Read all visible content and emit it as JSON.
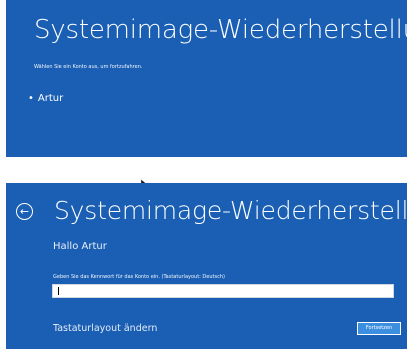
{
  "screen1": {
    "title": "Systemimage-Wiederherstellung",
    "instruction": "Wählen Sie ein Konto aus, um fortzufahren.",
    "accounts": [
      "Artur"
    ]
  },
  "screen2": {
    "title": "Systemimage-Wiederherstellung",
    "greeting": "Hallo Artur",
    "password_label": "Geben Sie das Kennwort für das Konto ein. (Tastaturlayout: Deutsch)",
    "password_value": "",
    "change_layout": "Tastaturlayout ändern",
    "continue_label": "Fortsetzen"
  },
  "icons": {
    "back": "arrow-left-circle-icon",
    "pointer": "mouse-cursor-icon"
  },
  "colors": {
    "background": "#1a5fb4",
    "button": "#3b8ee0",
    "text": "#ffffff"
  }
}
